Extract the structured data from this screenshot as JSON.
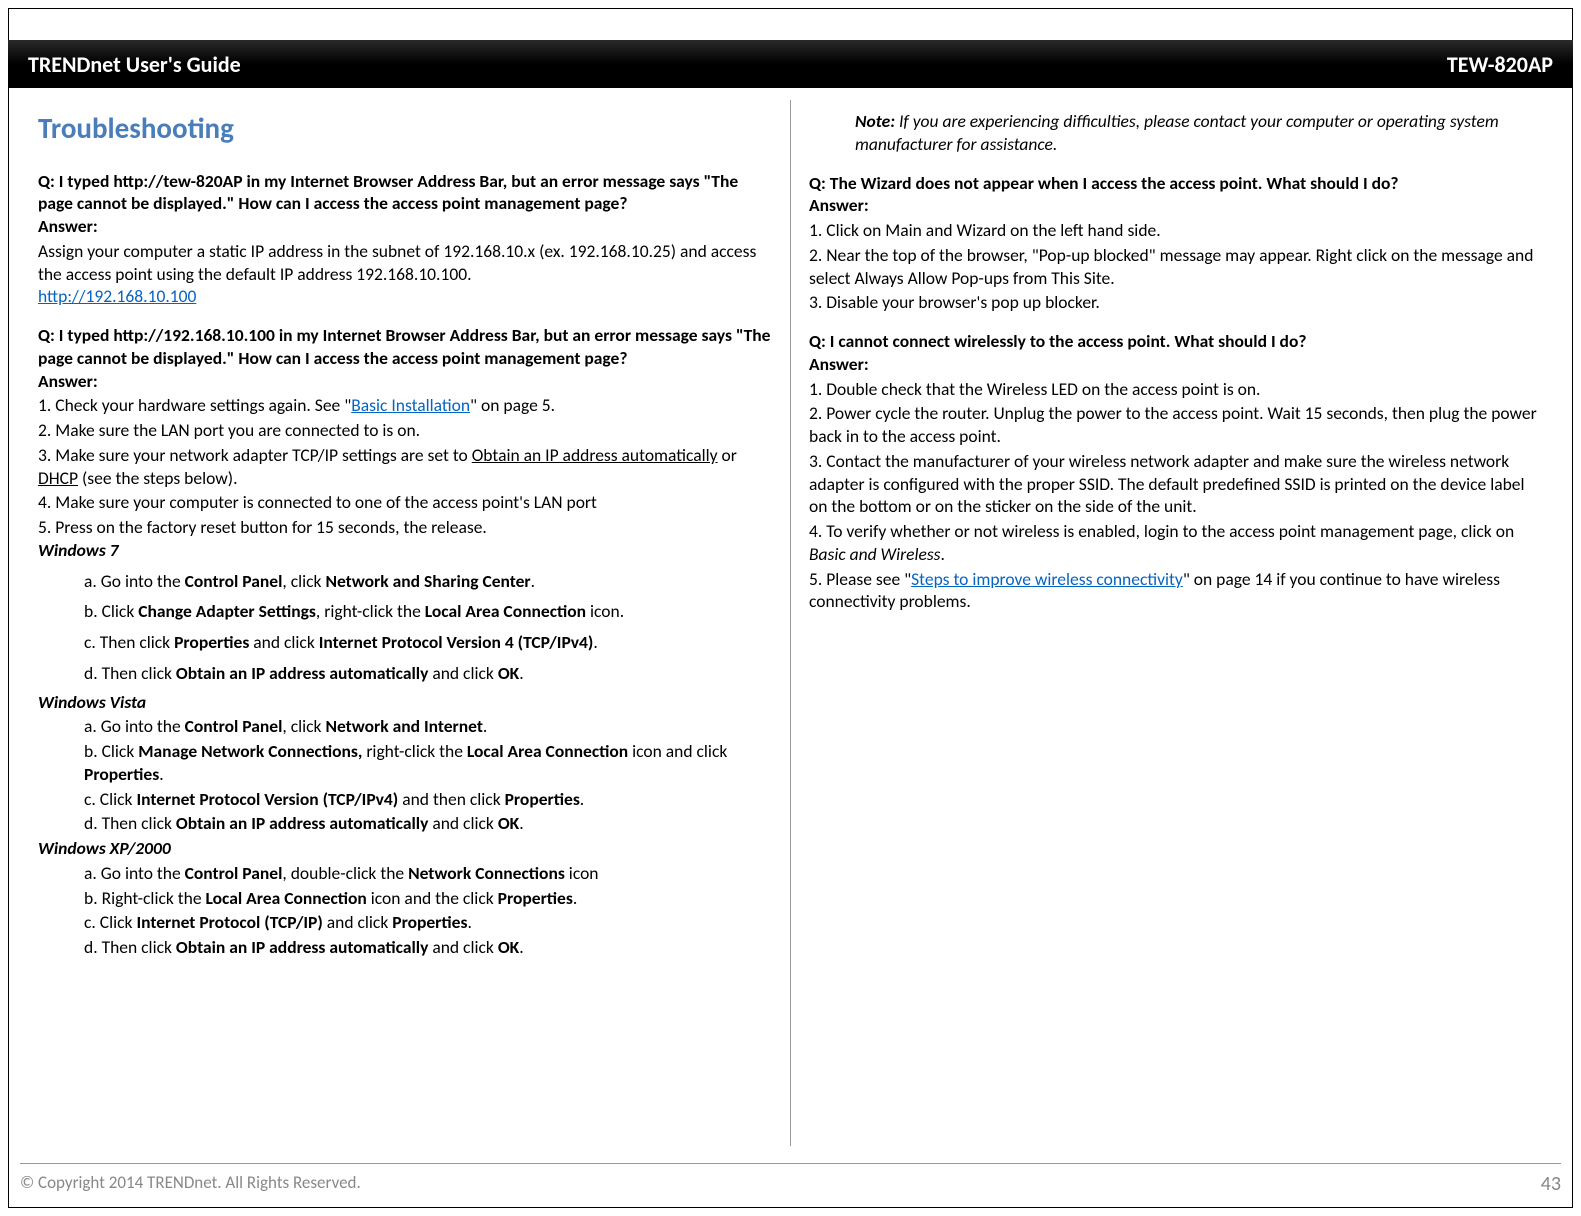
{
  "header": {
    "left": "TRENDnet User's Guide",
    "right": "TEW-820AP"
  },
  "title": "Troubleshooting",
  "q1": {
    "q": "Q: I typed http://tew-820AP in my Internet Browser Address Bar, but an error message says \"The page cannot be displayed.\" How can I access the access point management page?",
    "ans_label": "Answer:",
    "ans": "Assign your computer a static IP address in the subnet of 192.168.10.x (ex. 192.168.10.25) and access the access point using the default IP address 192.168.10.100.",
    "link": "http://192.168.10.100"
  },
  "q2": {
    "q": "Q: I typed http://192.168.10.100 in my Internet Browser Address Bar, but an error message says \"The page cannot be displayed.\" How can I access the access point management page?",
    "ans_label": "Answer:",
    "s1a": "1. Check your hardware settings again. See \"",
    "s1link": "Basic Installation",
    "s1b": "\" on page 5.",
    "s2": "2. Make sure the LAN port you are connected to is on.",
    "s3a": "3. Make sure your network adapter TCP/IP settings are set to ",
    "s3u1": "Obtain an IP address automatically",
    "s3b": " or ",
    "s3u2": "DHCP",
    "s3c": " (see the steps below).",
    "s4": "4. Make sure your computer is connected to one of the access point's LAN port",
    "s5": "5. Press on the factory reset button for 15 seconds, the release."
  },
  "win7": {
    "title": "Windows 7",
    "a_pre": "a. Go into the ",
    "a_b1": "Control Panel",
    "a_mid": ", click ",
    "a_b2": "Network and Sharing Center",
    "a_post": ".",
    "b_pre": "b. Click ",
    "b_b1": "Change Adapter Settings",
    "b_mid": ", right-click the ",
    "b_b2": "Local Area Connection",
    "b_post": " icon.",
    "c_pre": "c. Then click ",
    "c_b1": "Properties",
    "c_mid": " and click ",
    "c_b2": "Internet Protocol Version 4 (TCP/IPv4)",
    "c_post": ".",
    "d_pre": "d. Then click ",
    "d_b1": "Obtain an IP address automatically",
    "d_mid": " and click ",
    "d_b2": "OK",
    "d_post": "."
  },
  "vista": {
    "title": "Windows Vista",
    "a_pre": "a. Go into the ",
    "a_b1": "Control Panel",
    "a_mid": ", click ",
    "a_b2": "Network and Internet",
    "a_post": ".",
    "b_pre": "b. Click ",
    "b_b1": "Manage Network Connections,",
    "b_mid": " right-click the ",
    "b_b2": "Local Area Connection",
    "b_post1": " icon and click ",
    "b_b3": "Properties",
    "b_post2": ".",
    "c_pre": "c. Click ",
    "c_b1": "Internet Protocol Version (TCP/IPv4)",
    "c_mid": " and then click ",
    "c_b2": "Properties",
    "c_post": ".",
    "d_pre": "d. Then click ",
    "d_b1": "Obtain an IP address automatically",
    "d_mid": " and click ",
    "d_b2": "OK",
    "d_post": "."
  },
  "xp": {
    "title": "Windows XP/2000",
    "a_pre": "a. Go into the ",
    "a_b1": "Control Panel",
    "a_mid": ", double-click the ",
    "a_b2": "Network Connections",
    "a_post": " icon",
    "b_pre": "b. Right-click the ",
    "b_b1": "Local Area Connection",
    "b_mid": " icon and the click ",
    "b_b2": "Properties",
    "b_post": ".",
    "c_pre": "c. Click ",
    "c_b1": "Internet Protocol (TCP/IP)",
    "c_mid": " and click ",
    "c_b2": "Properties",
    "c_post": ".",
    "d_pre": "d. Then click ",
    "d_b1": "Obtain an IP address automatically",
    "d_mid": " and click ",
    "d_b2": "OK",
    "d_post": "."
  },
  "note": {
    "label": "Note:",
    "text": " If you are experiencing difficulties, please contact your computer or operating system manufacturer for assistance."
  },
  "q3": {
    "q": "Q: The Wizard does not appear when I access the access point. What should I do?",
    "ans_label": "Answer:",
    "s1": "1. Click on Main and Wizard on the left hand side.",
    "s2": "2. Near the top of the browser, \"Pop-up blocked\" message may appear. Right click on the message and select Always Allow Pop-ups from This Site.",
    "s3": "3. Disable your browser's pop up blocker."
  },
  "q4": {
    "q": "Q: I cannot connect wirelessly to the access point. What should I do?",
    "ans_label": "Answer:",
    "s1": "1. Double check that the Wireless LED on the access point is on.",
    "s2": "2. Power cycle the router. Unplug the power to the access point. Wait 15 seconds, then plug the power back in to the access point.",
    "s3": "3. Contact the manufacturer of your wireless network adapter and make sure the wireless network adapter is configured with the proper SSID. The default predefined SSID is printed on the device label on the bottom or on the sticker on the side of the unit.",
    "s4a": "4. To verify whether or not wireless is enabled, login to the access point management page, click on ",
    "s4i": "Basic and Wireless",
    "s4b": ".",
    "s5a": "5. Please see \"",
    "s5link": "Steps to improve wireless connectivity",
    "s5b": "\" on page 14 if you continue to have wireless connectivity problems."
  },
  "footer": {
    "copyright": "© Copyright 2014 TRENDnet. All Rights Reserved.",
    "page": "43"
  }
}
